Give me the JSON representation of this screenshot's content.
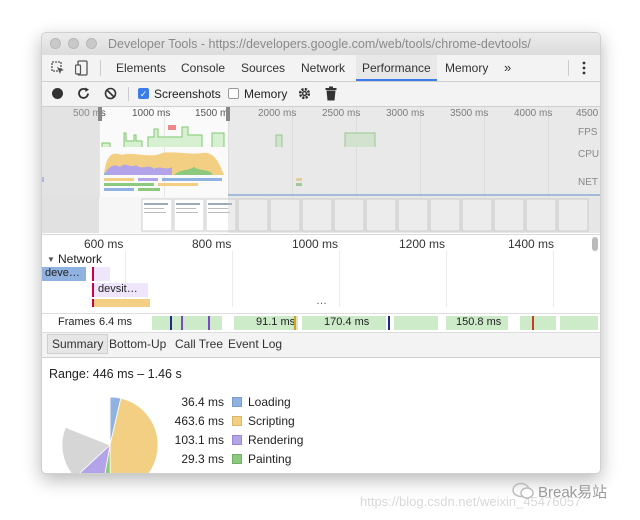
{
  "window": {
    "title": "Developer Tools - https://developers.google.com/web/tools/chrome-devtools/"
  },
  "tabs": [
    "Elements",
    "Console",
    "Sources",
    "Network",
    "Performance",
    "Memory"
  ],
  "tabs_more": "»",
  "active_tab": "Performance",
  "toolbar": {
    "screenshots_label": "Screenshots",
    "screenshots_checked": true,
    "memory_label": "Memory",
    "memory_checked": false
  },
  "overview": {
    "ruler": [
      "500 ms",
      "1000 ms",
      "1500 m",
      "2000 ms",
      "2500 ms",
      "3000 ms",
      "3500 ms",
      "4000 ms",
      "4500"
    ],
    "fps_label": "FPS",
    "cpu_label": "CPU",
    "net_label": "NET"
  },
  "detail_axis": [
    "600 ms",
    "800 ms",
    "1000 ms",
    "1200 ms",
    "1400 ms"
  ],
  "network": {
    "label": "Network",
    "item1": "deve…",
    "item2": "devsit…",
    "more": "…"
  },
  "frames": {
    "label": "Frames",
    "values": [
      "6.4 ms",
      "91.1 ms",
      "170.4 ms",
      "150.8 ms"
    ]
  },
  "subtabs": [
    "Summary",
    "Bottom-Up",
    "Call Tree",
    "Event Log"
  ],
  "summary": {
    "range": "Range: 446 ms – 1.46 s",
    "items": [
      {
        "value": "36.4 ms",
        "label": "Loading",
        "color": "#8fb2e0"
      },
      {
        "value": "463.6 ms",
        "label": "Scripting",
        "color": "#f2cf82"
      },
      {
        "value": "103.1 ms",
        "label": "Rendering",
        "color": "#b3a3e8"
      },
      {
        "value": "29.3 ms",
        "label": "Painting",
        "color": "#8cc97f"
      }
    ]
  },
  "watermark": {
    "url": "https://blog.csdn.net/weixin_45476057",
    "brand": "Break易站"
  },
  "colors": {
    "accent": "#3b7ce9",
    "fps": "#7ec86f",
    "scripting": "#f2cf82",
    "rendering": "#b3a3e8"
  }
}
